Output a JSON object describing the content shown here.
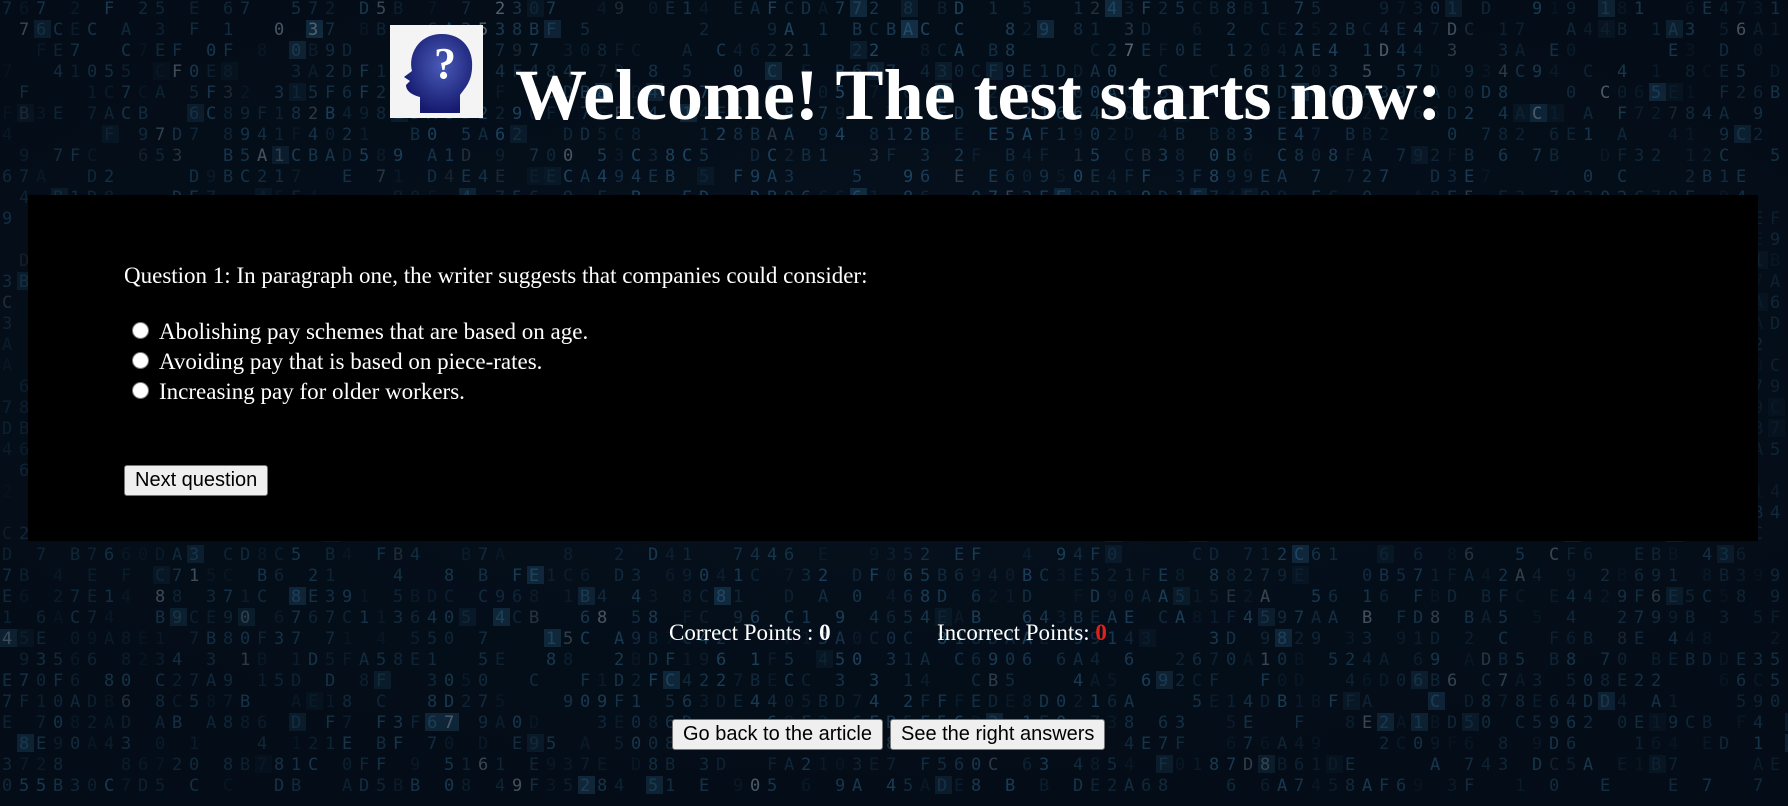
{
  "header": {
    "title": "Welcome! The test starts now:",
    "logo_icon": "head-question-mark-icon"
  },
  "quiz": {
    "question": "Question 1: In paragraph one, the writer suggests that companies could consider:",
    "options": [
      {
        "label": "Abolishing pay schemes that are based on age.",
        "selected": false
      },
      {
        "label": "Avoiding pay that is based on piece-rates.",
        "selected": false
      },
      {
        "label": "Increasing pay for older workers.",
        "selected": false
      }
    ],
    "next_label": "Next question"
  },
  "scores": {
    "correct_label": "Correct Points : ",
    "correct_value": "0",
    "incorrect_label": "Incorrect Points: ",
    "incorrect_value": "0"
  },
  "buttons": {
    "back_label": "Go back to the article",
    "answers_label": "See the right answers"
  },
  "colors": {
    "panel": "#000000",
    "incorrect_value": "#e3211b",
    "background": "#06121f",
    "background_glyph": "#3f8fc2"
  }
}
